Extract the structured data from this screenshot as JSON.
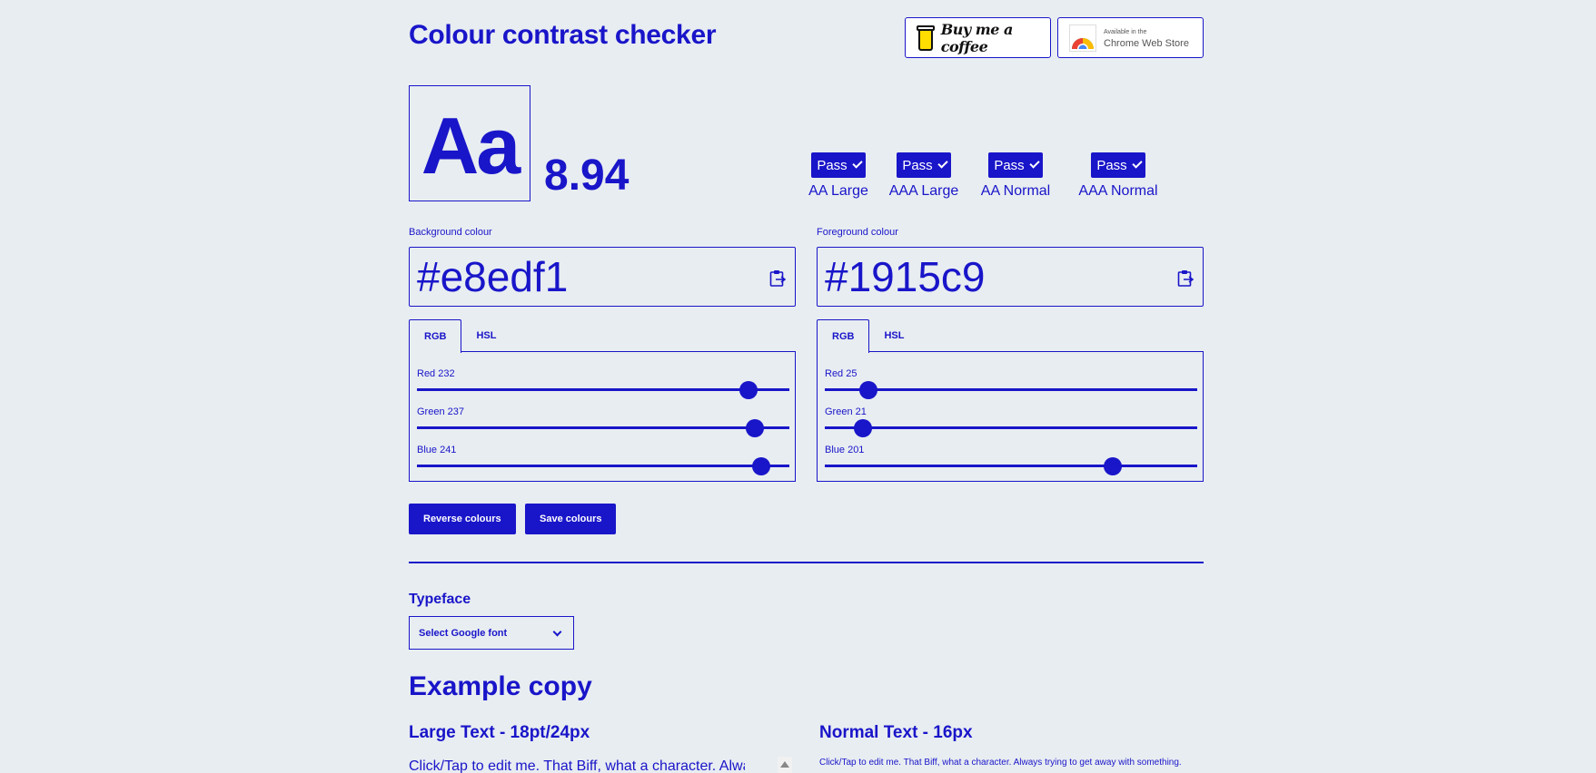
{
  "header": {
    "title": "Colour contrast checker",
    "coffee_label": "Buy me a coffee",
    "chrome_small": "Available in the",
    "chrome_big": "Chrome Web Store"
  },
  "preview": {
    "sample": "Aa",
    "ratio": "8.94"
  },
  "results": [
    {
      "status": "Pass",
      "label": "AA Large"
    },
    {
      "status": "Pass",
      "label": "AAA Large"
    },
    {
      "status": "Pass",
      "label": "AA Normal"
    },
    {
      "status": "Pass",
      "label": "AAA Normal"
    }
  ],
  "background": {
    "label": "Background colour",
    "hex": "#e8edf1",
    "tabs": [
      "RGB",
      "HSL"
    ],
    "sliders": [
      {
        "label": "Red 232",
        "value": 232,
        "max": 255
      },
      {
        "label": "Green 237",
        "value": 237,
        "max": 255
      },
      {
        "label": "Blue 241",
        "value": 241,
        "max": 255
      }
    ]
  },
  "foreground": {
    "label": "Foreground colour",
    "hex": "#1915c9",
    "tabs": [
      "RGB",
      "HSL"
    ],
    "sliders": [
      {
        "label": "Red 25",
        "value": 25,
        "max": 255
      },
      {
        "label": "Green 21",
        "value": 21,
        "max": 255
      },
      {
        "label": "Blue 201",
        "value": 201,
        "max": 255
      }
    ]
  },
  "actions": {
    "reverse": "Reverse colours",
    "save": "Save colours"
  },
  "typeface": {
    "label": "Typeface",
    "selected": "Select Google font"
  },
  "example": {
    "title": "Example copy",
    "large_title": "Large Text - 18pt/24px",
    "normal_title": "Normal Text - 16px",
    "large_copy": "Click/Tap to edit me. That Biff, what a character. Always",
    "normal_copy": "Click/Tap to edit me. That Biff, what a character. Always trying to get away with something."
  },
  "colors": {
    "background": "#e8edf1",
    "accent": "#1915c9"
  }
}
